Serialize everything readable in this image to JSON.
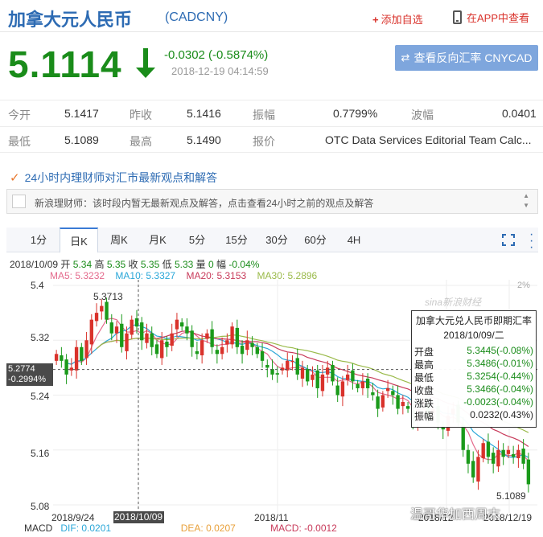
{
  "header": {
    "name": "加拿大元人民币",
    "code": "(CADCNY)",
    "watch_label": "添加自选",
    "app_label": "在APP中查看"
  },
  "quote": {
    "price": "5.1114",
    "change": "-0.0302 (-0.5874%)",
    "time": "2018-12-19 04:14:59",
    "reverse_button": "查看反向汇率 CNYCAD",
    "direction": "down",
    "color_down": "#1a8c1a"
  },
  "stats": {
    "row1": [
      {
        "label": "今开",
        "value": "5.1417"
      },
      {
        "label": "昨收",
        "value": "5.1416"
      },
      {
        "label": "振幅",
        "value": "0.7799%"
      },
      {
        "label": "波幅",
        "value": "0.0401"
      }
    ],
    "row2": [
      {
        "label": "最低",
        "value": "5.1089"
      },
      {
        "label": "最高",
        "value": "5.1490"
      },
      {
        "label": "报价",
        "value": "OTC Data Services Editorial Team Calc..."
      }
    ]
  },
  "advisor": {
    "title": "24小时内理财师对汇市最新观点和解答",
    "message": "新浪理财师：该时段内暂无最新观点及解答，点击查看24小时之前的观点及解答"
  },
  "tabs": [
    {
      "label": "1分"
    },
    {
      "label": "日K",
      "active": true
    },
    {
      "label": "周K"
    },
    {
      "label": "月K"
    },
    {
      "label": "5分"
    },
    {
      "label": "15分"
    },
    {
      "label": "30分"
    },
    {
      "label": "60分"
    },
    {
      "label": "4H"
    }
  ],
  "kline_info": {
    "date": "2018/10/09",
    "open_label": "开",
    "open": "5.34",
    "high_label": "高",
    "high": "5.35",
    "close_label": "收",
    "close": "5.35",
    "low_label": "低",
    "low": "5.33",
    "vol_label": "量",
    "vol": "0",
    "amp_label": "幅",
    "amp": "-0.04%"
  },
  "ma": [
    {
      "label": "MA5: 5.3232",
      "color": "#e46a8c"
    },
    {
      "label": "MA10: 5.3327",
      "color": "#2aa7d8"
    },
    {
      "label": "MA20: 5.3153",
      "color": "#c83a5a"
    },
    {
      "label": "MA30: 5.2896",
      "color": "#9aba4a"
    }
  ],
  "chart": {
    "y_ticks": [
      "5.4",
      "5.32",
      "5.24",
      "5.16",
      "5.08"
    ],
    "y_values": [
      5.4,
      5.32,
      5.24,
      5.16,
      5.08
    ],
    "x_ticks": [
      "2018/9/24",
      "2018/10/09",
      "2018/11",
      "2018/12",
      "2018/12/19"
    ],
    "pct_label": "2%",
    "cursor_price": "5.2774",
    "cursor_pct": "-0.2994%",
    "high_marker": "5.3713",
    "low_marker": "5.1089",
    "watermark": "sina新浪财经",
    "up_color": "#d9322b",
    "down_color": "#1a9a1a"
  },
  "tooltip": {
    "title": "加拿大元兑人民币即期汇率",
    "date": "2018/10/09/二",
    "rows": [
      {
        "k": "开盘",
        "v": "5.3445(-0.08%)"
      },
      {
        "k": "最高",
        "v": "5.3486(-0.01%)"
      },
      {
        "k": "最低",
        "v": "5.3254(-0.44%)"
      },
      {
        "k": "收盘",
        "v": "5.3466(-0.04%)"
      },
      {
        "k": "涨跌",
        "v": "-0.0023(-0.04%)"
      },
      {
        "k": "振幅",
        "v": "0.0232(0.43%)"
      }
    ]
  },
  "macd": {
    "label": "MACD",
    "dif": "DIF: 0.0201",
    "dea": "DEA: 0.0207",
    "macd": "MACD: -0.0012"
  },
  "overlay_watermark": "温哥华加西周末"
}
